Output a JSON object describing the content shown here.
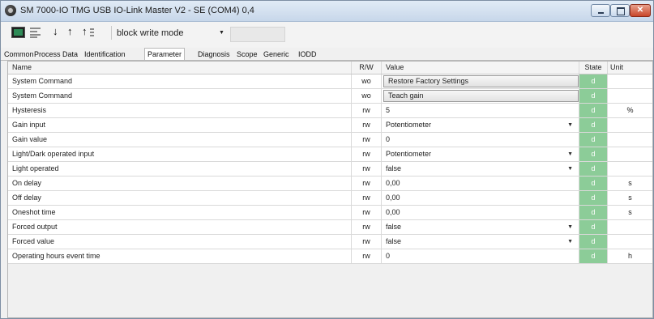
{
  "window": {
    "title": "SM 7000-IO   TMG USB IO-Link Master V2 - SE (COM4) 0,4",
    "close_glyph": "✕"
  },
  "toolbar": {
    "icons": [
      "monitor-icon",
      "list-icon",
      "arrow-down-icon",
      "arrow-up-icon",
      "arrow-up-list-icon"
    ],
    "mode_select": "block write mode",
    "arrow_down": "↓",
    "arrow_up": "↑",
    "arrow_up_list": "↑"
  },
  "tabs": [
    {
      "label": "Common"
    },
    {
      "label": "Process Data"
    },
    {
      "label": "Identification"
    },
    {
      "label": "Parameter",
      "active": true
    },
    {
      "label": "Diagnosis"
    },
    {
      "label": "Scope"
    },
    {
      "label": "Generic"
    },
    {
      "label": "IODD"
    }
  ],
  "table": {
    "columns": {
      "name": "Name",
      "rw": "R/W",
      "value": "Value",
      "state": "State",
      "unit": "Unit"
    },
    "rows": [
      {
        "name": "System Command",
        "rw": "wo",
        "value": "Restore Factory Settings",
        "kind": "button",
        "state": "d",
        "unit": ""
      },
      {
        "name": "System Command",
        "rw": "wo",
        "value": "Teach gain",
        "kind": "button",
        "state": "d",
        "unit": ""
      },
      {
        "name": "Hysteresis",
        "rw": "rw",
        "value": "5",
        "kind": "text",
        "state": "d",
        "unit": "%"
      },
      {
        "name": "Gain input",
        "rw": "rw",
        "value": "Potentiometer",
        "kind": "dropdown",
        "state": "d",
        "unit": ""
      },
      {
        "name": "Gain value",
        "rw": "rw",
        "value": "0",
        "kind": "text",
        "state": "d",
        "unit": ""
      },
      {
        "name": "Light/Dark operated input",
        "rw": "rw",
        "value": "Potentiometer",
        "kind": "dropdown",
        "state": "d",
        "unit": ""
      },
      {
        "name": "Light operated",
        "rw": "rw",
        "value": "false",
        "kind": "dropdown",
        "state": "d",
        "unit": ""
      },
      {
        "name": "On delay",
        "rw": "rw",
        "value": "0,00",
        "kind": "text",
        "state": "d",
        "unit": "s"
      },
      {
        "name": "Off delay",
        "rw": "rw",
        "value": "0,00",
        "kind": "text",
        "state": "d",
        "unit": "s"
      },
      {
        "name": "Oneshot time",
        "rw": "rw",
        "value": "0,00",
        "kind": "text",
        "state": "d",
        "unit": "s"
      },
      {
        "name": "Forced output",
        "rw": "rw",
        "value": "false",
        "kind": "dropdown",
        "state": "d",
        "unit": ""
      },
      {
        "name": "Forced value",
        "rw": "rw",
        "value": "false",
        "kind": "dropdown",
        "state": "d",
        "unit": ""
      },
      {
        "name": "Operating hours event time",
        "rw": "rw",
        "value": "0",
        "kind": "text",
        "state": "d",
        "unit": "h"
      }
    ]
  },
  "colors": {
    "state_cell": "#8ccc98",
    "title_gradient_top": "#e1ebf6",
    "close_button": "#c8462a"
  }
}
